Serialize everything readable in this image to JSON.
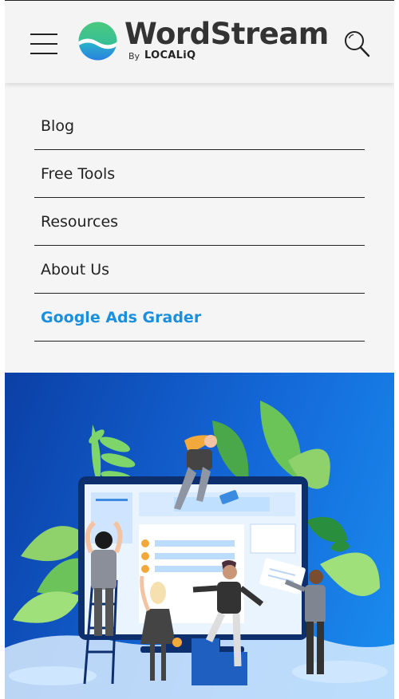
{
  "header": {
    "brand_name": "WordStream",
    "brand_by": "By",
    "brand_partner": "LOCALiQ",
    "menu_icon": "hamburger-icon",
    "search_icon": "search-icon"
  },
  "menu": {
    "items": [
      {
        "label": "Blog"
      },
      {
        "label": "Free Tools"
      },
      {
        "label": "Resources"
      },
      {
        "label": "About Us"
      },
      {
        "label": "Google Ads Grader",
        "highlight": true
      }
    ]
  },
  "colors": {
    "accent": "#1a8fdd",
    "hero_blue": "#1468d8",
    "logo_teal": "#2dbfa0",
    "logo_blue": "#2a8de0"
  }
}
